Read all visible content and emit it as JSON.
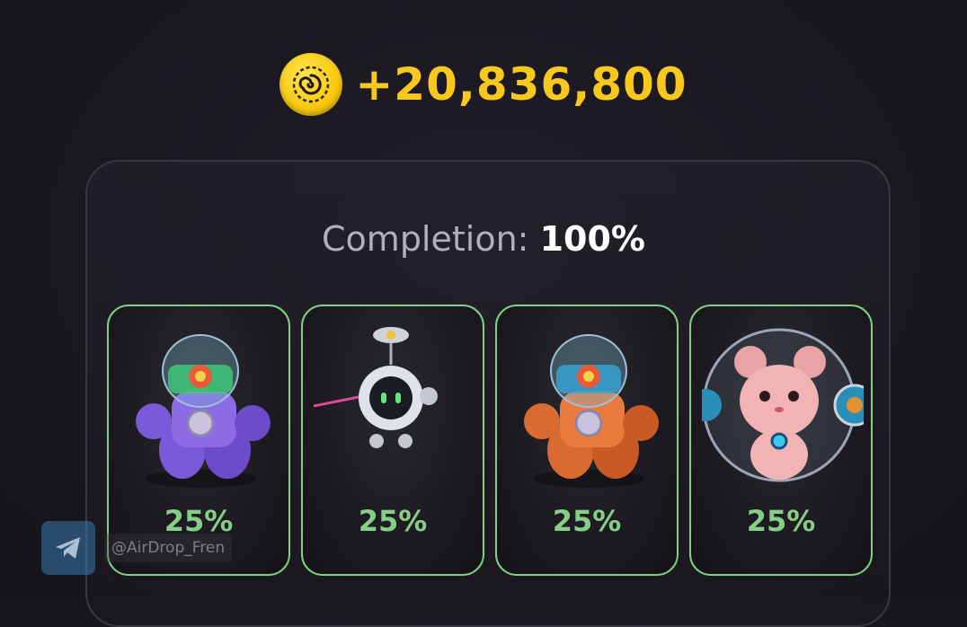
{
  "reward": {
    "icon": "coin-icon",
    "amount": "+20,836,800",
    "color": "#f8c91c"
  },
  "completion": {
    "label": "Completion:",
    "value": "100%"
  },
  "cards": [
    {
      "name": "purple-mech",
      "icon": "purple-mech-robot-illustration",
      "share": "25%"
    },
    {
      "name": "floating-bot",
      "icon": "floating-robot-illustration",
      "share": "25%"
    },
    {
      "name": "orange-mech",
      "icon": "orange-mech-robot-illustration",
      "share": "25%"
    },
    {
      "name": "hamster-ball",
      "icon": "hamster-in-ball-illustration",
      "share": "25%"
    }
  ],
  "watermark": {
    "icon": "telegram-icon",
    "handle": "@AirDrop_Fren"
  },
  "colors": {
    "accent_gold": "#f8c91c",
    "card_border": "#7fd185",
    "share_text": "#86cf88"
  }
}
